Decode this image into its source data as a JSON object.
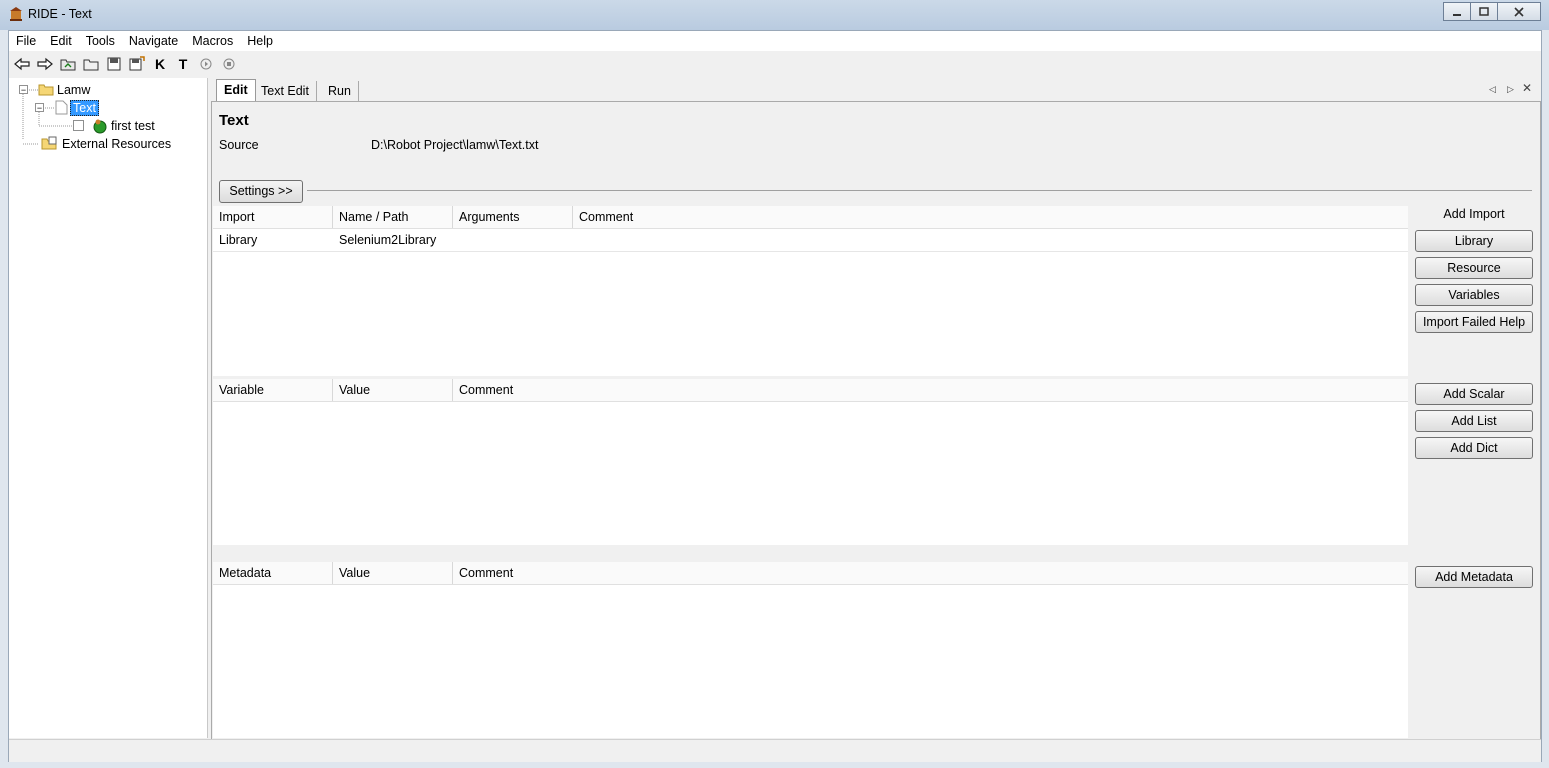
{
  "window": {
    "title": "RIDE - Text"
  },
  "menu": [
    "File",
    "Edit",
    "Tools",
    "Navigate",
    "Macros",
    "Help"
  ],
  "toolbar": {
    "icons": [
      "back-arrow-icon",
      "forward-arrow-icon",
      "open-test-suite-icon",
      "open-directory-icon",
      "save-icon",
      "save-all-icon",
      "search-keywords-icon",
      "search-tests-icon",
      "play-icon",
      "stop-icon"
    ],
    "k_glyph": "K",
    "t_glyph": "T"
  },
  "tree": {
    "root": "Lamw",
    "suite": "Text",
    "test": "first test",
    "external": "External Resources"
  },
  "tabs": [
    "Edit",
    "Text Edit",
    "Run"
  ],
  "editor": {
    "title": "Text",
    "source_label": "Source",
    "source_value": "D:\\Robot Project\\lamw\\Text.txt",
    "settings_button": "Settings >>"
  },
  "imports": {
    "columns": [
      "Import",
      "Name / Path",
      "Arguments",
      "Comment"
    ],
    "rows": [
      {
        "import": "Library",
        "name": "Selenium2Library",
        "arguments": "",
        "comment": ""
      }
    ],
    "add_label": "Add Import",
    "buttons": [
      "Library",
      "Resource",
      "Variables",
      "Import Failed Help"
    ]
  },
  "variables": {
    "columns": [
      "Variable",
      "Value",
      "Comment"
    ],
    "buttons": [
      "Add Scalar",
      "Add List",
      "Add Dict"
    ]
  },
  "metadata": {
    "columns": [
      "Metadata",
      "Value",
      "Comment"
    ],
    "buttons": [
      "Add Metadata"
    ]
  }
}
